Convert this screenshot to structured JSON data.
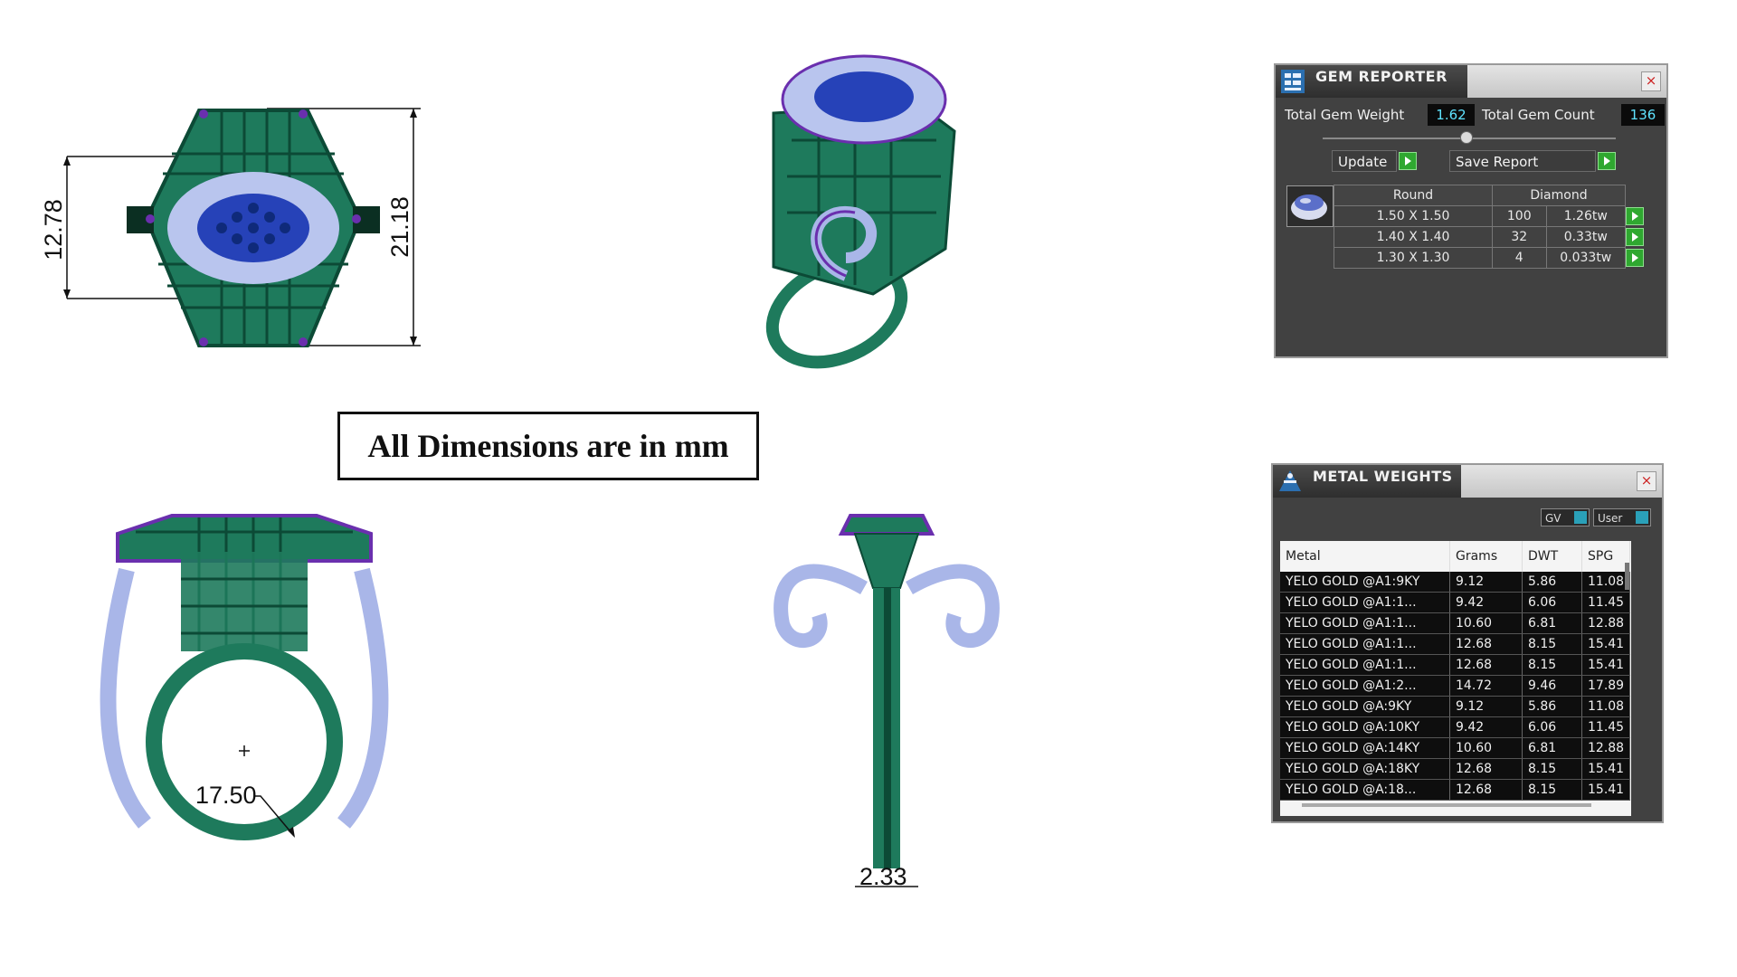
{
  "dimensions": {
    "top_height": "12.78",
    "top_total": "21.18",
    "ring_inner": "17.50",
    "shank_width": "2.33"
  },
  "note": "All Dimensions are in mm",
  "gem_reporter": {
    "title": "GEM REPORTER",
    "close": "×",
    "total_weight_label": "Total Gem Weight",
    "total_weight": "1.62",
    "total_count_label": "Total Gem Count",
    "total_count": "136",
    "update_label": "Update",
    "save_label": "Save Report",
    "shape": "Round",
    "material": "Diamond",
    "rows": [
      {
        "size": "1.50 X 1.50",
        "count": "100",
        "weight": "1.26tw"
      },
      {
        "size": "1.40 X 1.40",
        "count": "32",
        "weight": "0.33tw"
      },
      {
        "size": "1.30 X 1.30",
        "count": "4",
        "weight": "0.033tw"
      }
    ]
  },
  "metal_weights": {
    "title": "METAL WEIGHTS",
    "close": "×",
    "gv_label": "GV",
    "user_label": "User",
    "headers": [
      "Metal",
      "Grams",
      "DWT",
      "SPG"
    ],
    "rows": [
      [
        "YELO GOLD @A1:9KY",
        "9.12",
        "5.86",
        "11.08"
      ],
      [
        "YELO GOLD @A1:1...",
        "9.42",
        "6.06",
        "11.45"
      ],
      [
        "YELO GOLD @A1:1...",
        "10.60",
        "6.81",
        "12.88"
      ],
      [
        "YELO GOLD @A1:1...",
        "12.68",
        "8.15",
        "15.41"
      ],
      [
        "YELO GOLD @A1:1...",
        "12.68",
        "8.15",
        "15.41"
      ],
      [
        "YELO GOLD @A1:2...",
        "14.72",
        "9.46",
        "17.89"
      ],
      [
        "YELO GOLD @A:9KY",
        "9.12",
        "5.86",
        "11.08"
      ],
      [
        "YELO GOLD @A:10KY",
        "9.42",
        "6.06",
        "11.45"
      ],
      [
        "YELO GOLD @A:14KY",
        "10.60",
        "6.81",
        "12.88"
      ],
      [
        "YELO GOLD @A:18KY",
        "12.68",
        "8.15",
        "15.41"
      ],
      [
        "YELO GOLD @A:18...",
        "12.68",
        "8.15",
        "15.41"
      ]
    ]
  },
  "colors": {
    "metal": "#1e7a5c",
    "metal_dark": "#0c4a36",
    "gem_light": "#a9b6e8",
    "gem_blue": "#2642b8",
    "prong": "#6a2fae"
  }
}
